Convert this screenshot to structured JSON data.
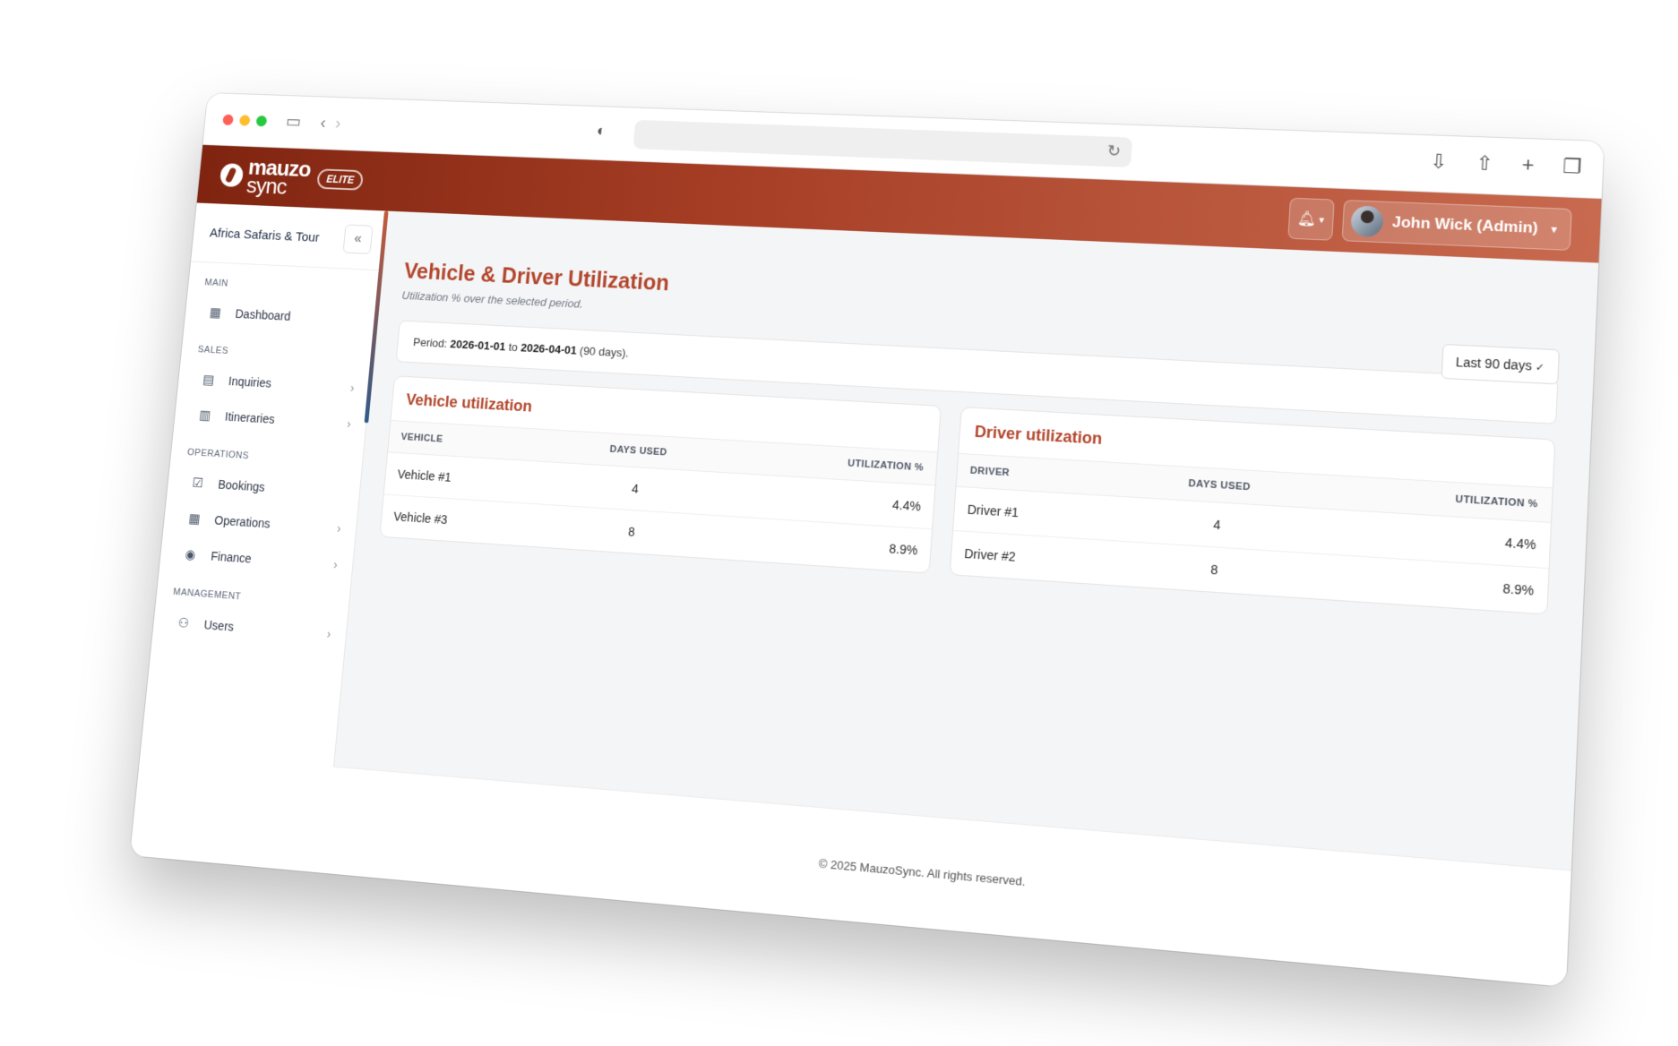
{
  "browser": {
    "back_icon": "chevron-left-icon",
    "forward_icon": "chevron-right-icon",
    "sidebar_icon": "sidebar-toggle-icon"
  },
  "header": {
    "logo_text_top": "mauzo",
    "logo_text_bottom": "sync",
    "badge": "ELITE",
    "user_name": "John Wick (Admin)",
    "brand_color_start": "#7f2410",
    "brand_color_end": "#c86a4f"
  },
  "sidebar": {
    "company": "Africa Safaris & Tour",
    "sections": {
      "main": "MAIN",
      "sales": "SALES",
      "operations": "OPERATIONS",
      "management": "MANAGEMENT"
    },
    "items": [
      {
        "label": "Dashboard",
        "icon": "dashboard-icon"
      },
      {
        "label": "Inquiries",
        "icon": "inquiries-icon"
      },
      {
        "label": "Itineraries",
        "icon": "map-icon"
      },
      {
        "label": "Bookings",
        "icon": "calendar-check-icon"
      },
      {
        "label": "Operations",
        "icon": "calendar-icon"
      },
      {
        "label": "Finance",
        "icon": "coins-icon"
      },
      {
        "label": "Users",
        "icon": "users-icon"
      }
    ]
  },
  "main": {
    "title": "Vehicle & Driver Utilization",
    "subtitle": "Utilization % over the selected period.",
    "range_select": "Last 90 days",
    "period": {
      "prefix": "Period:",
      "start": "2026-01-01",
      "to": "to",
      "end": "2026-04-01",
      "suffix": "(90 days)."
    },
    "vehicle_card": {
      "title": "Vehicle utilization",
      "headers": [
        "VEHICLE",
        "DAYS USED",
        "UTILIZATION %"
      ],
      "rows": [
        [
          "Vehicle #1",
          "4",
          "4.4%"
        ],
        [
          "Vehicle #3",
          "8",
          "8.9%"
        ]
      ]
    },
    "driver_card": {
      "title": "Driver utilization",
      "headers": [
        "DRIVER",
        "DAYS USED",
        "UTILIZATION %"
      ],
      "rows": [
        [
          "Driver #1",
          "4",
          "4.4%"
        ],
        [
          "Driver #2",
          "8",
          "8.9%"
        ]
      ]
    }
  },
  "footer": {
    "text": "© 2025 MauzoSync. All rights reserved."
  }
}
